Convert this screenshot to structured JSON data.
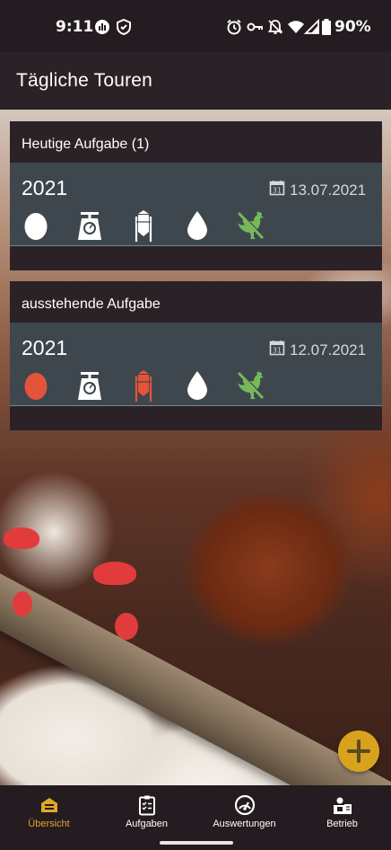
{
  "status_bar": {
    "time": "9:11",
    "battery": "90%",
    "icons": [
      "signal-app-icon",
      "shield-icon",
      "alarm-icon",
      "key-icon",
      "notifications-off-icon",
      "wifi-icon",
      "cell-signal-icon",
      "battery-icon"
    ]
  },
  "app_bar": {
    "title": "Tägliche Touren"
  },
  "cards": [
    {
      "header": "Heutige Aufgabe (1)",
      "task": {
        "year": "2021",
        "date": "13.07.2021",
        "icons": [
          {
            "name": "egg-icon",
            "color": "#ffffff"
          },
          {
            "name": "scale-icon",
            "color": "#ffffff"
          },
          {
            "name": "silo-icon",
            "color": "#ffffff"
          },
          {
            "name": "water-drop-icon",
            "color": "#ffffff"
          },
          {
            "name": "no-hen-icon",
            "color": "#76b95b"
          }
        ]
      }
    },
    {
      "header": "ausstehende Aufgabe",
      "task": {
        "year": "2021",
        "date": "12.07.2021",
        "icons": [
          {
            "name": "egg-icon",
            "color": "#e4543a"
          },
          {
            "name": "scale-icon",
            "color": "#ffffff"
          },
          {
            "name": "silo-icon",
            "color": "#e4543a"
          },
          {
            "name": "water-drop-icon",
            "color": "#ffffff"
          },
          {
            "name": "no-hen-icon",
            "color": "#76b95b"
          }
        ]
      }
    }
  ],
  "fab": {
    "icon": "plus-icon"
  },
  "bottom_nav": {
    "active": "uebersicht",
    "items": [
      {
        "label": "Übersicht",
        "icon": "barn-icon"
      },
      {
        "label": "Aufgaben",
        "icon": "clipboard-icon"
      },
      {
        "label": "Auswertungen",
        "icon": "gauge-icon"
      },
      {
        "label": "Betrieb",
        "icon": "farmer-icon"
      }
    ]
  },
  "colors": {
    "bar_background": "#241c21",
    "card_background": "#2b2227",
    "task_row_background": "#3d474d",
    "accent": "#d9a21e",
    "warning": "#e4543a",
    "ok_green": "#76b95b"
  }
}
